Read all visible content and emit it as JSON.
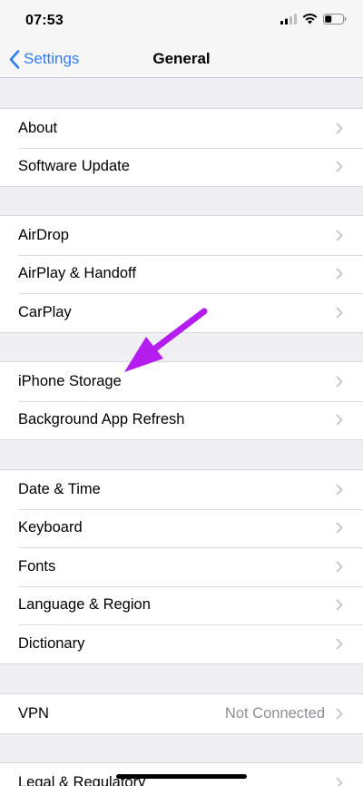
{
  "status_bar": {
    "time": "07:53"
  },
  "nav": {
    "back_label": "Settings",
    "title": "General"
  },
  "groups": [
    {
      "rows": [
        {
          "label": "About"
        },
        {
          "label": "Software Update"
        }
      ]
    },
    {
      "rows": [
        {
          "label": "AirDrop"
        },
        {
          "label": "AirPlay & Handoff"
        },
        {
          "label": "CarPlay"
        }
      ]
    },
    {
      "rows": [
        {
          "label": "iPhone Storage"
        },
        {
          "label": "Background App Refresh"
        }
      ]
    },
    {
      "rows": [
        {
          "label": "Date & Time"
        },
        {
          "label": "Keyboard"
        },
        {
          "label": "Fonts"
        },
        {
          "label": "Language & Region"
        },
        {
          "label": "Dictionary"
        }
      ]
    },
    {
      "rows": [
        {
          "label": "VPN",
          "value": "Not Connected"
        }
      ]
    },
    {
      "rows": [
        {
          "label": "Legal & Regulatory"
        }
      ]
    }
  ],
  "colors": {
    "accent": "#2f7cf6",
    "annotation_arrow": "#b41cf0",
    "background": "#efeff4"
  },
  "icons": [
    "signal-icon",
    "wifi-icon",
    "battery-icon",
    "back-chevron-icon",
    "chevron-right-icon"
  ]
}
